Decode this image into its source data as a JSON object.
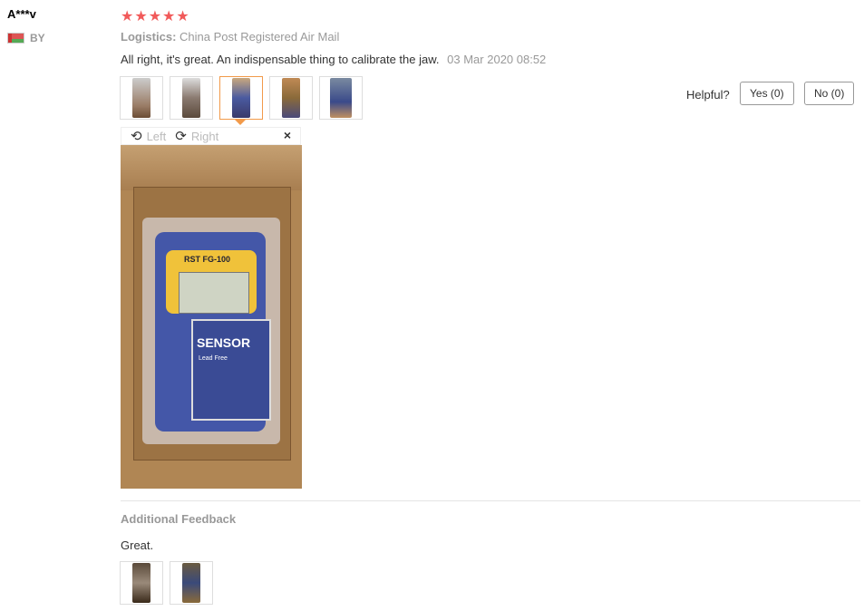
{
  "review": {
    "user_name": "A***v",
    "country": "BY",
    "rating_stars": "★★★★★",
    "logistics_label": "Logistics:",
    "logistics_value": "China Post Registered Air Mail",
    "text": "All right, it's great. An indispensable thing to calibrate the jaw.",
    "date": "03 Mar 2020 08:52",
    "helpful_label": "Helpful?",
    "yes_label": "Yes (0)",
    "no_label": "No (0)"
  },
  "viewer": {
    "rotate_left": "Left",
    "rotate_right": "Right",
    "close": "×",
    "product_model": "RST FG-100",
    "product_brand": "SENSOR",
    "product_sub": "Lead Free"
  },
  "additional": {
    "label": "Additional Feedback",
    "text": "Great."
  },
  "colors": {
    "star": "#f15a5a",
    "accent": "#f29a4a"
  }
}
